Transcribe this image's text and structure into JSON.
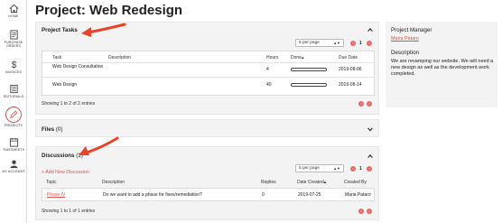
{
  "sidebar": {
    "items": [
      {
        "label": "HOME",
        "icon": "home-icon"
      },
      {
        "label": "PURCHASE ORDERS",
        "icon": "document-icon"
      },
      {
        "label": "INVOICES",
        "icon": "dollar-icon"
      },
      {
        "label": "EDITORIALS",
        "icon": "editorial-icon"
      },
      {
        "label": "PROJECTS",
        "icon": "pencil-icon"
      },
      {
        "label": "TIMESHEETS",
        "icon": "calendar-icon"
      },
      {
        "label": "MY ACCOUNT",
        "icon": "user-icon"
      }
    ]
  },
  "page": {
    "title": "Project: Web Redesign"
  },
  "tasks": {
    "title": "Project Tasks",
    "per_page": "5 per page",
    "page_number": "1",
    "columns": [
      "Task",
      "Description",
      "Hours",
      "Done",
      "Due Date"
    ],
    "done_sort": "▴",
    "rows": [
      {
        "task": "Web Design Consultation",
        "description": "",
        "hours": "4",
        "done": 0,
        "due": "2019-08-06"
      },
      {
        "task": "Web Design",
        "description": "",
        "hours": "40",
        "done": 0,
        "due": "2019-08-14"
      }
    ],
    "showing": "Showing 1 to 2 of 2 entries"
  },
  "files": {
    "title": "Files",
    "count": "(0)"
  },
  "discussions": {
    "title": "Discussions",
    "count": "(1)",
    "add_label": "+ Add New Discussion",
    "per_page": "5 per page",
    "page_number": "1",
    "columns": [
      "Topic",
      "Description",
      "Replies",
      "Date Created",
      "Created By"
    ],
    "date_sort": "▴",
    "rows": [
      {
        "topic": "Phase IV",
        "description": "Do we want to add a phase for fixes/remediation?",
        "replies": "0",
        "date": "2019-07-25",
        "created_by": "Maria Pataro"
      }
    ],
    "showing": "Showing 1 to 1 of 1 entries"
  },
  "side": {
    "manager_heading": "Project Manager",
    "manager_name": "Maria Pataro",
    "description_heading": "Description",
    "description_text": "We are revamping our website. We will need a new design as well as the development work completed."
  },
  "colors": {
    "accent": "#d9534f",
    "annotation_arrow": "#e8442a",
    "panel_bg": "#f3f3f3"
  }
}
